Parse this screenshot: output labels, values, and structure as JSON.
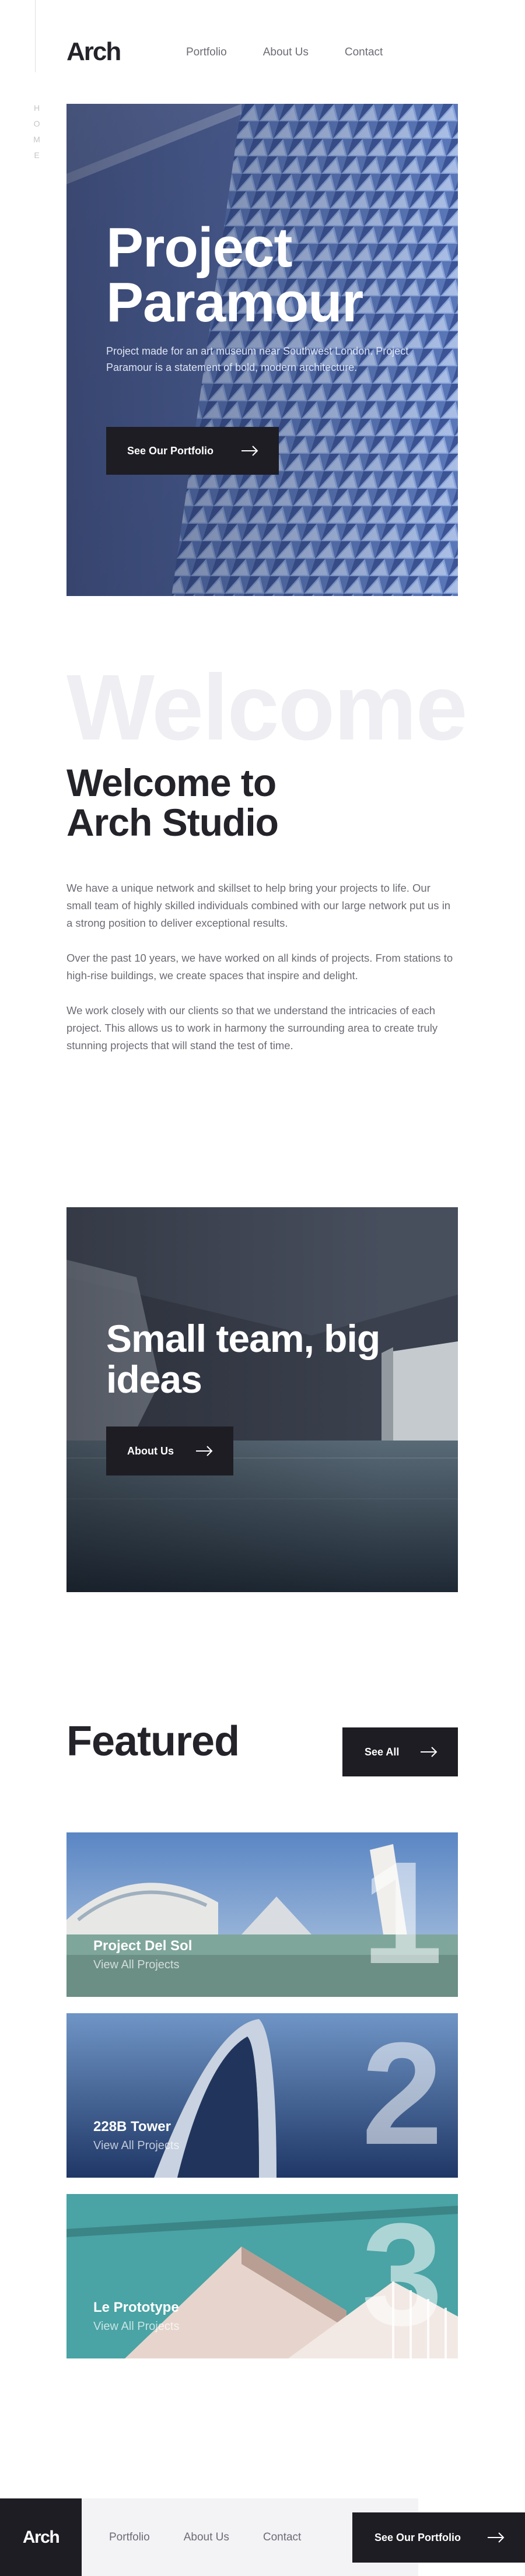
{
  "brand": {
    "logo": "Arch"
  },
  "nav": {
    "portfolio": "Portfolio",
    "about": "About Us",
    "contact": "Contact"
  },
  "sidebar": {
    "page_label": [
      "H",
      "O",
      "M",
      "E"
    ]
  },
  "hero": {
    "title": "Project Paramour",
    "description": "Project made for an art museum near Southwest London. Project Paramour is a statement of bold, modern architecture.",
    "button_label": "See Our Portfolio"
  },
  "welcome": {
    "background_word": "Welcome",
    "title": "Welcome to Arch Studio",
    "paragraphs": [
      "We have a unique network and skillset to help bring your projects to life. Our small team of highly skilled individuals combined with our large network put us in a strong position to deliver exceptional results.",
      "Over the past 10 years, we have worked on all kinds of projects. From stations to high-rise buildings, we create spaces that inspire and delight.",
      "We work closely with our clients so that we understand the intricacies of each project. This allows us to work in harmony the surrounding area to create truly stunning projects that will stand the test of time."
    ]
  },
  "small_team": {
    "title": "Small team, big ideas",
    "button_label": "About Us"
  },
  "featured": {
    "title": "Featured",
    "button_label": "See All",
    "projects": [
      {
        "number": "1",
        "name": "Project Del Sol",
        "link": "View All Projects"
      },
      {
        "number": "2",
        "name": "228B Tower",
        "link": "View All Projects"
      },
      {
        "number": "3",
        "name": "Le Prototype",
        "link": "View All Projects"
      }
    ]
  },
  "footer": {
    "logo": "Arch",
    "portfolio": "Portfolio",
    "about": "About Us",
    "contact": "Contact",
    "button_label": "See Our Portfolio"
  },
  "colors": {
    "dark": "#1e1d23",
    "text": "#24232a",
    "muted": "#6c6b74",
    "light": "#eeeef3"
  }
}
